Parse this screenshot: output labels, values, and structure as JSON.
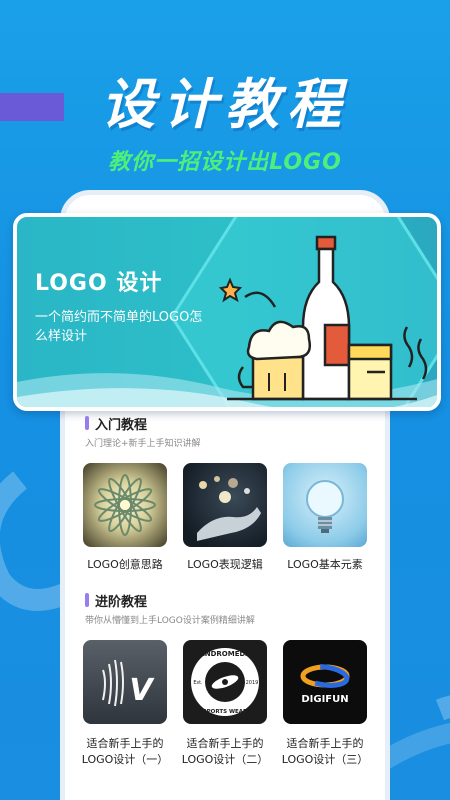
{
  "hero": {
    "title": "设计教程",
    "subtitle": "教你一招设计出LOGO"
  },
  "banner": {
    "title": "LOGO 设计",
    "description": "一个简约而不简单的LOGO怎么样设计"
  },
  "sections": [
    {
      "title": "入门教程",
      "description": "入门理论+新手上手知识讲解",
      "cards": [
        {
          "label": "LOGO创意思路"
        },
        {
          "label": "LOGO表现逻辑"
        },
        {
          "label": "LOGO基本元素"
        }
      ]
    },
    {
      "title": "进阶教程",
      "description": "带你从懵懂到上手LOGO设计案例精细讲解",
      "cards": [
        {
          "label_1": "适合新手上手的",
          "label_2": "LOGO设计（一）",
          "art_text": "V"
        },
        {
          "label_1": "适合新手上手的",
          "label_2": "LOGO设计（二）",
          "art_top": "ANDROMEDA",
          "art_bottom": "SPORTS WEAR",
          "art_left": "Est.",
          "art_right": "2019"
        },
        {
          "label_1": "适合新手上手的",
          "label_2": "LOGO设计（三）",
          "art_text": "DIGIFUN"
        }
      ]
    }
  ],
  "colors": {
    "background": "#1a96e4",
    "accent_green": "#4ef07a",
    "banner_teal": "#2dbfc8",
    "section_bar": "#9a7cf2"
  }
}
